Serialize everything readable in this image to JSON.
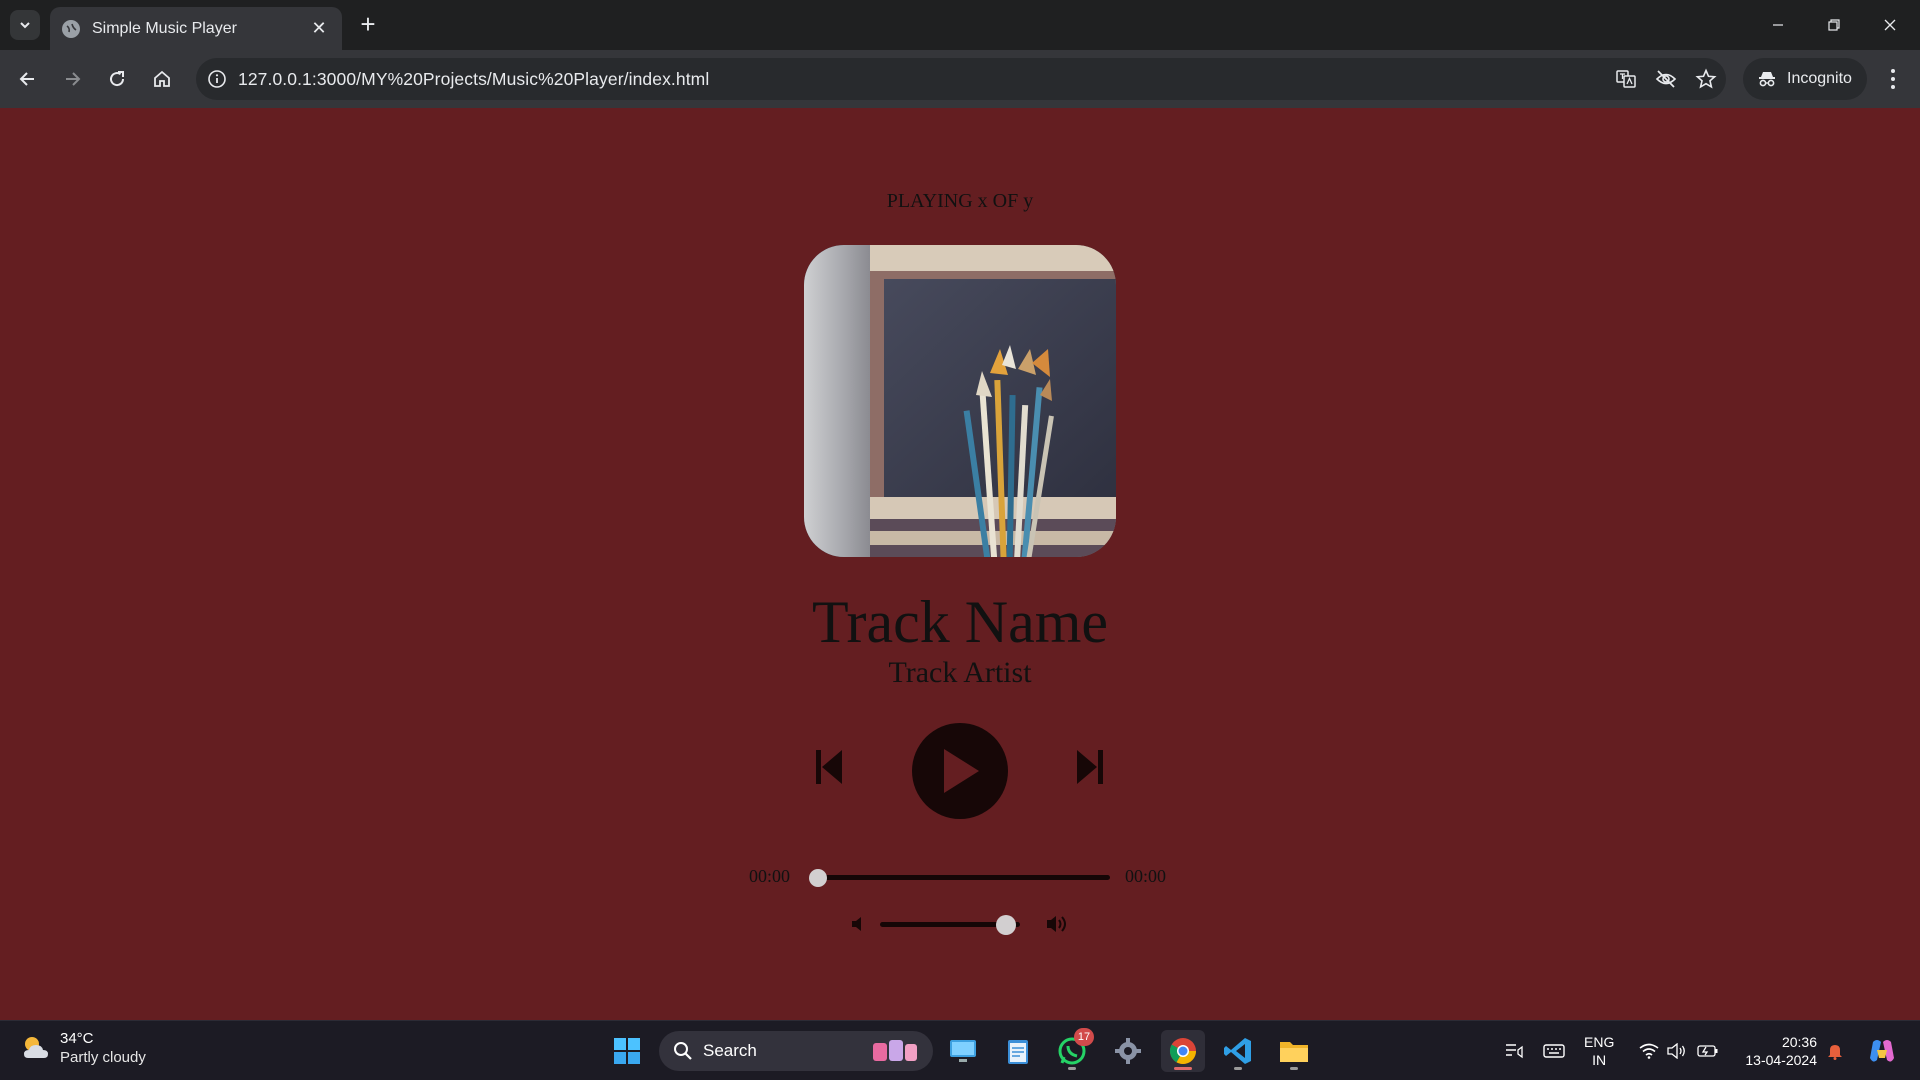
{
  "browser": {
    "tab_title": "Simple Music Player",
    "url": "127.0.0.1:3000/MY%20Projects/Music%20Player/index.html",
    "profile_label": "Incognito"
  },
  "player": {
    "now_playing": "PLAYING x OF y",
    "track_name": "Track Name",
    "track_artist": "Track Artist",
    "current_time": "00:00",
    "total_duration": "00:00",
    "seek_progress": 0,
    "volume_level": 0.9
  },
  "taskbar": {
    "weather_temp": "34°C",
    "weather_condition": "Partly cloudy",
    "search_placeholder": "Search",
    "whatsapp_badge": "17",
    "lang_line1": "ENG",
    "lang_line2": "IN",
    "time": "20:36",
    "date": "13-04-2024"
  },
  "colors": {
    "page_background": "#641e21",
    "play_button": "#170707",
    "slider_thumb": "#d2cfd0"
  }
}
